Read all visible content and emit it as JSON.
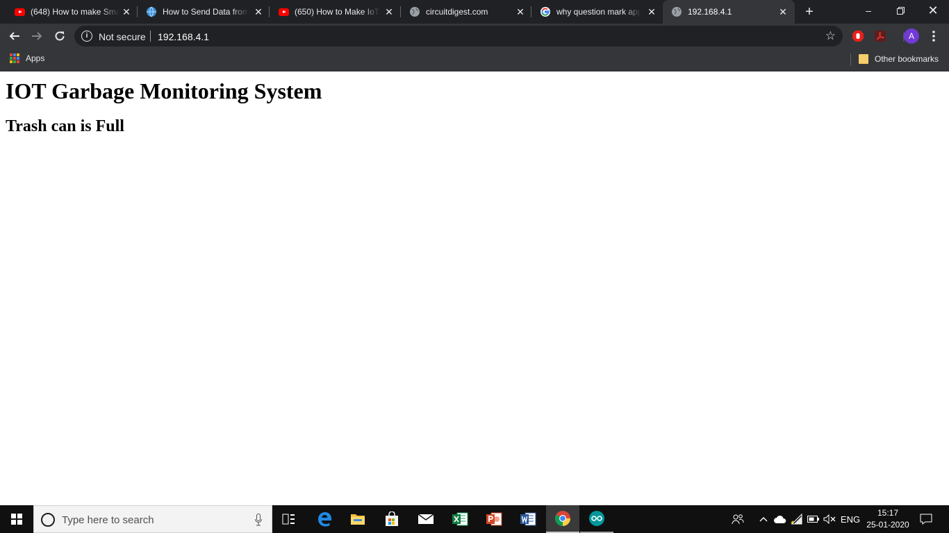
{
  "browser": {
    "tabs": [
      {
        "title": "(648) How to make Sma",
        "favicon": "youtube-icon"
      },
      {
        "title": "How to Send Data from",
        "favicon": "globe-icon"
      },
      {
        "title": "(650) How to Make IoT",
        "favicon": "youtube-icon"
      },
      {
        "title": "circuitdigest.com",
        "favicon": "globe-icon"
      },
      {
        "title": "why question mark app",
        "favicon": "google-icon"
      },
      {
        "title": "192.168.4.1",
        "favicon": "globe-icon",
        "active": true
      }
    ],
    "omnibox": {
      "security_label": "Not secure",
      "url": "192.168.4.1"
    },
    "profile_initial": "A",
    "bookmarks": {
      "apps_label": "Apps",
      "other_label": "Other bookmarks"
    }
  },
  "page": {
    "heading": "IOT Garbage Monitoring System",
    "status": "Trash can is Full"
  },
  "taskbar": {
    "search_placeholder": "Type here to search",
    "language": "ENG",
    "time": "15:17",
    "date": "25-01-2020"
  },
  "colors": {
    "tabstrip": "#202124",
    "toolbar": "#35363a",
    "omnibox": "#202124",
    "taskbar": "#101010",
    "profile": "#6f3ad6",
    "youtube": "#ff0000"
  }
}
